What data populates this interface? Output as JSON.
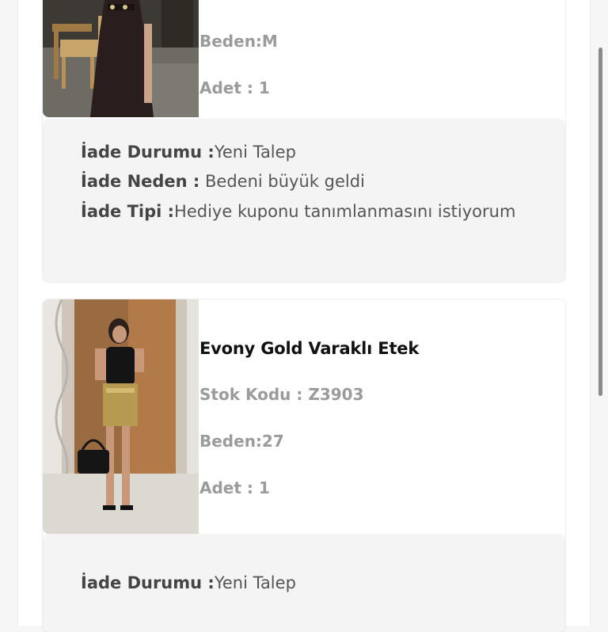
{
  "orders": [
    {
      "product_name": "",
      "stock_code": "",
      "size": "Beden:M",
      "quantity": "Adet : 1",
      "return_status_label": "İade Durumu :",
      "return_status_value": "Yeni Talep",
      "return_reason_label": "İade Neden :",
      "return_reason_value": " Bedeni büyük geldi",
      "return_type_label": "İade Tipi :",
      "return_type_value": "Hediye kuponu tanımlanmasını istiyorum"
    },
    {
      "product_name": "Evony Gold Varaklı Etek",
      "stock_code": "Stok Kodu : Z3903",
      "size": "Beden:27",
      "quantity": "Adet : 1",
      "return_status_label": "İade Durumu :",
      "return_status_value": "Yeni Talep"
    }
  ],
  "colors": {
    "title": "#111111",
    "meta_text": "#9b9b9b",
    "return_bg": "#f4f4f4",
    "label": "#444444",
    "value": "#555555"
  }
}
